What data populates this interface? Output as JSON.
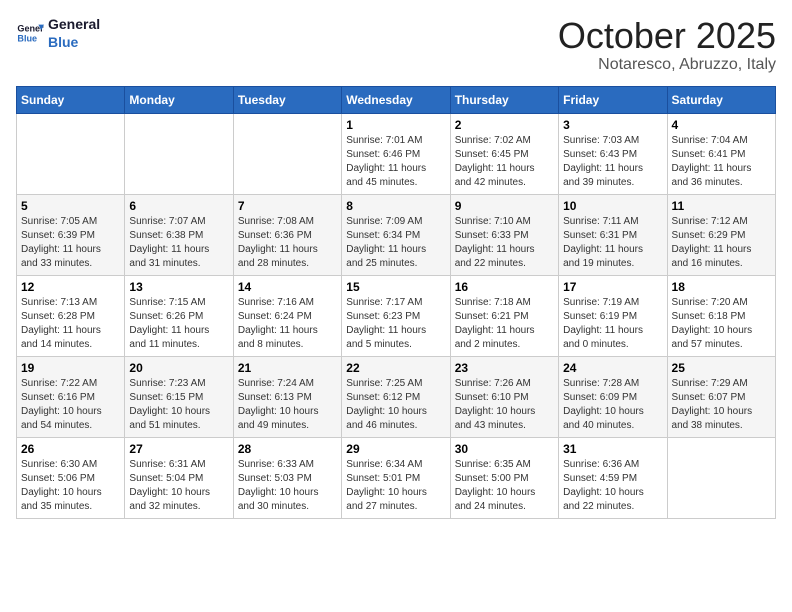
{
  "header": {
    "logo_line1": "General",
    "logo_line2": "Blue",
    "month": "October 2025",
    "location": "Notaresco, Abruzzo, Italy"
  },
  "weekdays": [
    "Sunday",
    "Monday",
    "Tuesday",
    "Wednesday",
    "Thursday",
    "Friday",
    "Saturday"
  ],
  "weeks": [
    [
      {
        "day": "",
        "info": ""
      },
      {
        "day": "",
        "info": ""
      },
      {
        "day": "",
        "info": ""
      },
      {
        "day": "1",
        "info": "Sunrise: 7:01 AM\nSunset: 6:46 PM\nDaylight: 11 hours\nand 45 minutes."
      },
      {
        "day": "2",
        "info": "Sunrise: 7:02 AM\nSunset: 6:45 PM\nDaylight: 11 hours\nand 42 minutes."
      },
      {
        "day": "3",
        "info": "Sunrise: 7:03 AM\nSunset: 6:43 PM\nDaylight: 11 hours\nand 39 minutes."
      },
      {
        "day": "4",
        "info": "Sunrise: 7:04 AM\nSunset: 6:41 PM\nDaylight: 11 hours\nand 36 minutes."
      }
    ],
    [
      {
        "day": "5",
        "info": "Sunrise: 7:05 AM\nSunset: 6:39 PM\nDaylight: 11 hours\nand 33 minutes."
      },
      {
        "day": "6",
        "info": "Sunrise: 7:07 AM\nSunset: 6:38 PM\nDaylight: 11 hours\nand 31 minutes."
      },
      {
        "day": "7",
        "info": "Sunrise: 7:08 AM\nSunset: 6:36 PM\nDaylight: 11 hours\nand 28 minutes."
      },
      {
        "day": "8",
        "info": "Sunrise: 7:09 AM\nSunset: 6:34 PM\nDaylight: 11 hours\nand 25 minutes."
      },
      {
        "day": "9",
        "info": "Sunrise: 7:10 AM\nSunset: 6:33 PM\nDaylight: 11 hours\nand 22 minutes."
      },
      {
        "day": "10",
        "info": "Sunrise: 7:11 AM\nSunset: 6:31 PM\nDaylight: 11 hours\nand 19 minutes."
      },
      {
        "day": "11",
        "info": "Sunrise: 7:12 AM\nSunset: 6:29 PM\nDaylight: 11 hours\nand 16 minutes."
      }
    ],
    [
      {
        "day": "12",
        "info": "Sunrise: 7:13 AM\nSunset: 6:28 PM\nDaylight: 11 hours\nand 14 minutes."
      },
      {
        "day": "13",
        "info": "Sunrise: 7:15 AM\nSunset: 6:26 PM\nDaylight: 11 hours\nand 11 minutes."
      },
      {
        "day": "14",
        "info": "Sunrise: 7:16 AM\nSunset: 6:24 PM\nDaylight: 11 hours\nand 8 minutes."
      },
      {
        "day": "15",
        "info": "Sunrise: 7:17 AM\nSunset: 6:23 PM\nDaylight: 11 hours\nand 5 minutes."
      },
      {
        "day": "16",
        "info": "Sunrise: 7:18 AM\nSunset: 6:21 PM\nDaylight: 11 hours\nand 2 minutes."
      },
      {
        "day": "17",
        "info": "Sunrise: 7:19 AM\nSunset: 6:19 PM\nDaylight: 11 hours\nand 0 minutes."
      },
      {
        "day": "18",
        "info": "Sunrise: 7:20 AM\nSunset: 6:18 PM\nDaylight: 10 hours\nand 57 minutes."
      }
    ],
    [
      {
        "day": "19",
        "info": "Sunrise: 7:22 AM\nSunset: 6:16 PM\nDaylight: 10 hours\nand 54 minutes."
      },
      {
        "day": "20",
        "info": "Sunrise: 7:23 AM\nSunset: 6:15 PM\nDaylight: 10 hours\nand 51 minutes."
      },
      {
        "day": "21",
        "info": "Sunrise: 7:24 AM\nSunset: 6:13 PM\nDaylight: 10 hours\nand 49 minutes."
      },
      {
        "day": "22",
        "info": "Sunrise: 7:25 AM\nSunset: 6:12 PM\nDaylight: 10 hours\nand 46 minutes."
      },
      {
        "day": "23",
        "info": "Sunrise: 7:26 AM\nSunset: 6:10 PM\nDaylight: 10 hours\nand 43 minutes."
      },
      {
        "day": "24",
        "info": "Sunrise: 7:28 AM\nSunset: 6:09 PM\nDaylight: 10 hours\nand 40 minutes."
      },
      {
        "day": "25",
        "info": "Sunrise: 7:29 AM\nSunset: 6:07 PM\nDaylight: 10 hours\nand 38 minutes."
      }
    ],
    [
      {
        "day": "26",
        "info": "Sunrise: 6:30 AM\nSunset: 5:06 PM\nDaylight: 10 hours\nand 35 minutes."
      },
      {
        "day": "27",
        "info": "Sunrise: 6:31 AM\nSunset: 5:04 PM\nDaylight: 10 hours\nand 32 minutes."
      },
      {
        "day": "28",
        "info": "Sunrise: 6:33 AM\nSunset: 5:03 PM\nDaylight: 10 hours\nand 30 minutes."
      },
      {
        "day": "29",
        "info": "Sunrise: 6:34 AM\nSunset: 5:01 PM\nDaylight: 10 hours\nand 27 minutes."
      },
      {
        "day": "30",
        "info": "Sunrise: 6:35 AM\nSunset: 5:00 PM\nDaylight: 10 hours\nand 24 minutes."
      },
      {
        "day": "31",
        "info": "Sunrise: 6:36 AM\nSunset: 4:59 PM\nDaylight: 10 hours\nand 22 minutes."
      },
      {
        "day": "",
        "info": ""
      }
    ]
  ]
}
